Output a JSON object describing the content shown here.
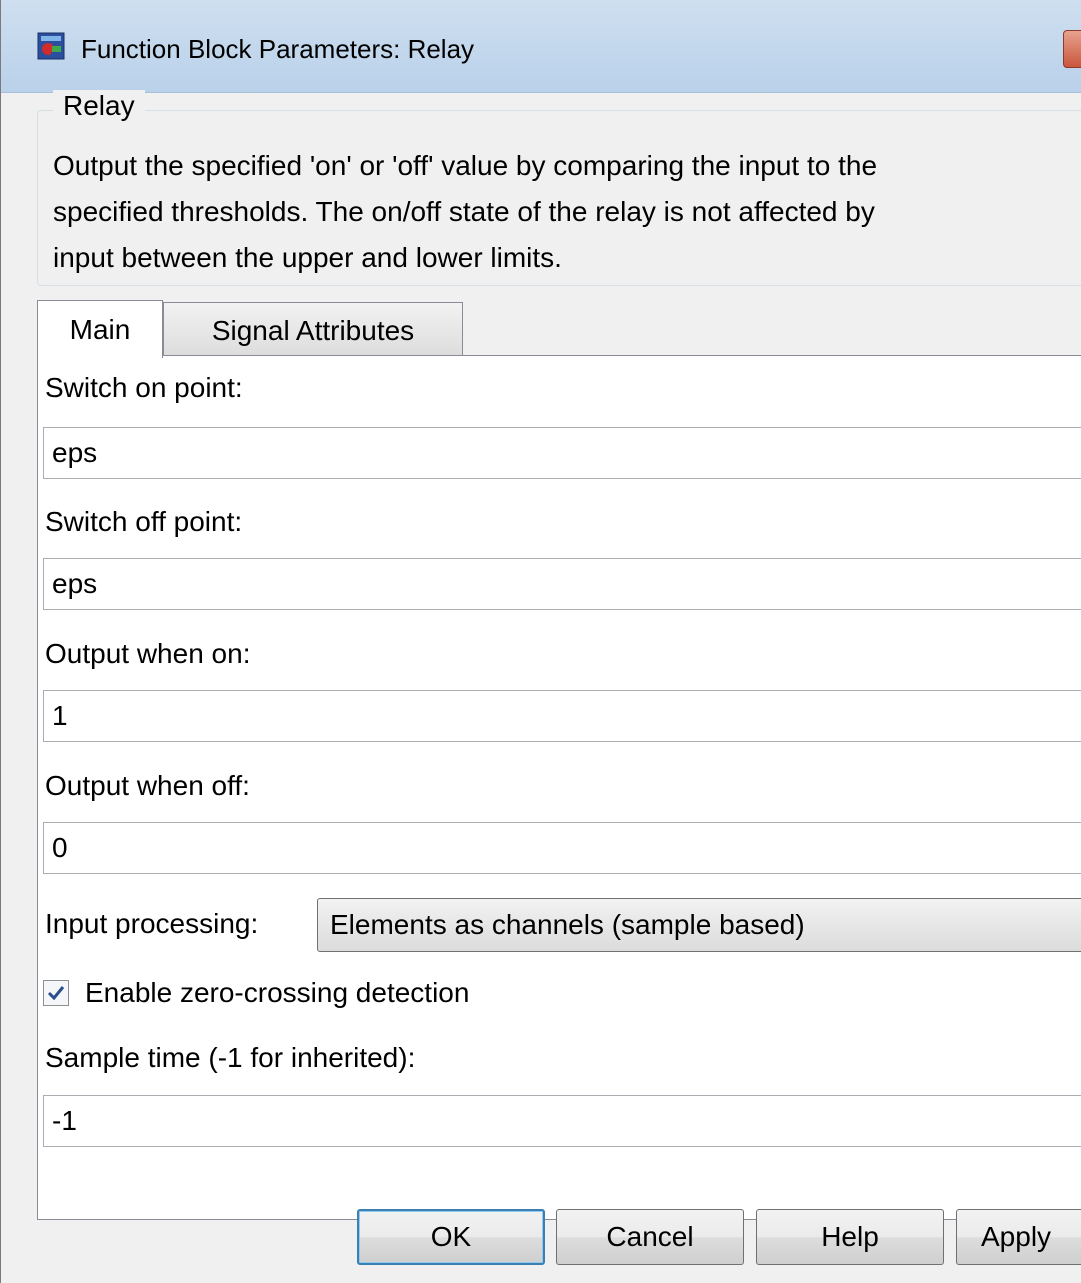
{
  "window": {
    "title": "Function Block Parameters: Relay"
  },
  "block": {
    "group_title": "Relay",
    "description": "Output the specified 'on' or 'off' value by comparing the input to the\nspecified thresholds.  The on/off state of the relay is not affected by\ninput between the upper and lower limits."
  },
  "tabs": [
    {
      "label": "Main",
      "selected": true
    },
    {
      "label": "Signal Attributes",
      "selected": false
    }
  ],
  "params": {
    "switch_on_label": "Switch on point:",
    "switch_on_value": "eps",
    "switch_off_label": "Switch off point:",
    "switch_off_value": "eps",
    "output_on_label": "Output when on:",
    "output_on_value": "1",
    "output_off_label": "Output when off:",
    "output_off_value": "0",
    "input_processing_label": "Input processing:",
    "input_processing_value": "Elements as channels (sample based)",
    "zero_crossing_label": "Enable zero-crossing detection",
    "zero_crossing_checked": true,
    "sample_time_label": "Sample time (-1 for inherited):",
    "sample_time_value": "-1"
  },
  "buttons": {
    "ok": "OK",
    "cancel": "Cancel",
    "help": "Help",
    "apply": "Apply"
  },
  "icons": {
    "app": "simulink-block-icon",
    "close": "close-icon",
    "checkmark": "checkmark-icon"
  }
}
